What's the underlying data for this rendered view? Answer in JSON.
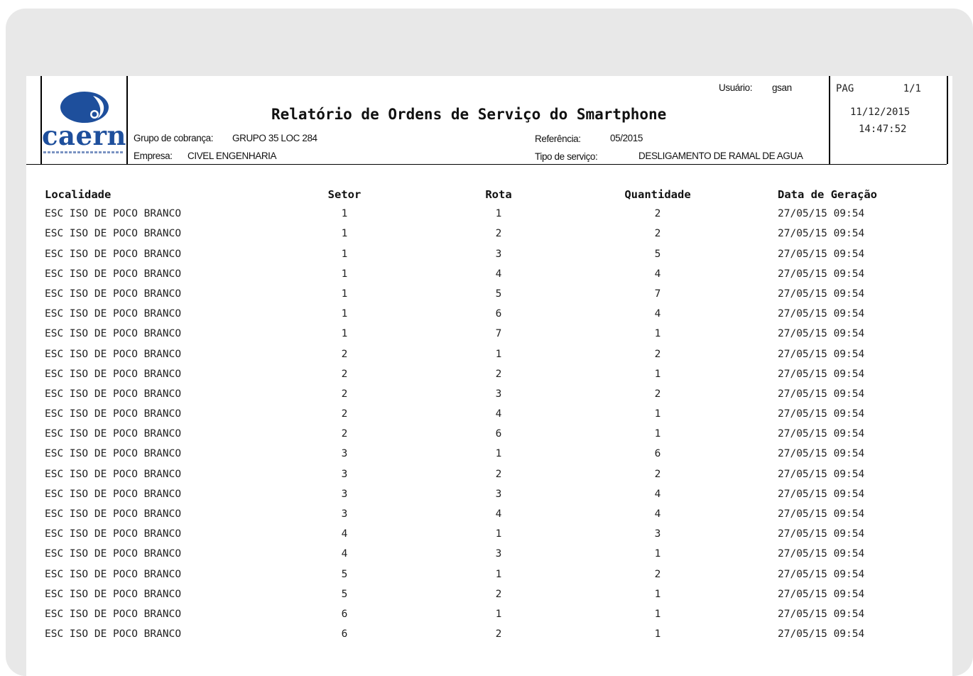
{
  "report": {
    "title": "Relatório de Ordens de Serviço do Smartphone",
    "logo_text": "caern"
  },
  "header_info": {
    "usuario_label": "Usuário:",
    "usuario_value": "gsan",
    "grupo_label": "Grupo de cobrança:",
    "grupo_value": "GRUPO 35 LOC 284",
    "empresa_label": "Empresa:",
    "empresa_value": "CIVEL ENGENHARIA",
    "referencia_label": "Referência:",
    "referencia_value": "05/2015",
    "tipo_label": "Tipo de serviço:",
    "tipo_value": "DESLIGAMENTO DE RAMAL DE AGUA"
  },
  "page_info": {
    "pag_label": "PAG",
    "pag_value": "1/1",
    "date": "11/12/2015",
    "time": "14:47:52"
  },
  "table": {
    "headers": [
      "Localidade",
      "Setor",
      "Rota",
      "Quantidade",
      "Data de Geração"
    ],
    "rows": [
      [
        "ESC ISO DE POCO BRANCO",
        "1",
        "1",
        "2",
        "27/05/15 09:54"
      ],
      [
        "ESC ISO DE POCO BRANCO",
        "1",
        "2",
        "2",
        "27/05/15 09:54"
      ],
      [
        "ESC ISO DE POCO BRANCO",
        "1",
        "3",
        "5",
        "27/05/15 09:54"
      ],
      [
        "ESC ISO DE POCO BRANCO",
        "1",
        "4",
        "4",
        "27/05/15 09:54"
      ],
      [
        "ESC ISO DE POCO BRANCO",
        "1",
        "5",
        "7",
        "27/05/15 09:54"
      ],
      [
        "ESC ISO DE POCO BRANCO",
        "1",
        "6",
        "4",
        "27/05/15 09:54"
      ],
      [
        "ESC ISO DE POCO BRANCO",
        "1",
        "7",
        "1",
        "27/05/15 09:54"
      ],
      [
        "ESC ISO DE POCO BRANCO",
        "2",
        "1",
        "2",
        "27/05/15 09:54"
      ],
      [
        "ESC ISO DE POCO BRANCO",
        "2",
        "2",
        "1",
        "27/05/15 09:54"
      ],
      [
        "ESC ISO DE POCO BRANCO",
        "2",
        "3",
        "2",
        "27/05/15 09:54"
      ],
      [
        "ESC ISO DE POCO BRANCO",
        "2",
        "4",
        "1",
        "27/05/15 09:54"
      ],
      [
        "ESC ISO DE POCO BRANCO",
        "2",
        "6",
        "1",
        "27/05/15 09:54"
      ],
      [
        "ESC ISO DE POCO BRANCO",
        "3",
        "1",
        "6",
        "27/05/15 09:54"
      ],
      [
        "ESC ISO DE POCO BRANCO",
        "3",
        "2",
        "2",
        "27/05/15 09:54"
      ],
      [
        "ESC ISO DE POCO BRANCO",
        "3",
        "3",
        "4",
        "27/05/15 09:54"
      ],
      [
        "ESC ISO DE POCO BRANCO",
        "3",
        "4",
        "4",
        "27/05/15 09:54"
      ],
      [
        "ESC ISO DE POCO BRANCO",
        "4",
        "1",
        "3",
        "27/05/15 09:54"
      ],
      [
        "ESC ISO DE POCO BRANCO",
        "4",
        "3",
        "1",
        "27/05/15 09:54"
      ],
      [
        "ESC ISO DE POCO BRANCO",
        "5",
        "1",
        "2",
        "27/05/15 09:54"
      ],
      [
        "ESC ISO DE POCO BRANCO",
        "5",
        "2",
        "1",
        "27/05/15 09:54"
      ],
      [
        "ESC ISO DE POCO BRANCO",
        "6",
        "1",
        "1",
        "27/05/15 09:54"
      ],
      [
        "ESC ISO DE POCO BRANCO",
        "6",
        "2",
        "1",
        "27/05/15 09:54"
      ]
    ]
  },
  "colors": {
    "frame_background": "#e8e8e8",
    "logo_blue": "#1e4f9c",
    "text": "#111111"
  }
}
